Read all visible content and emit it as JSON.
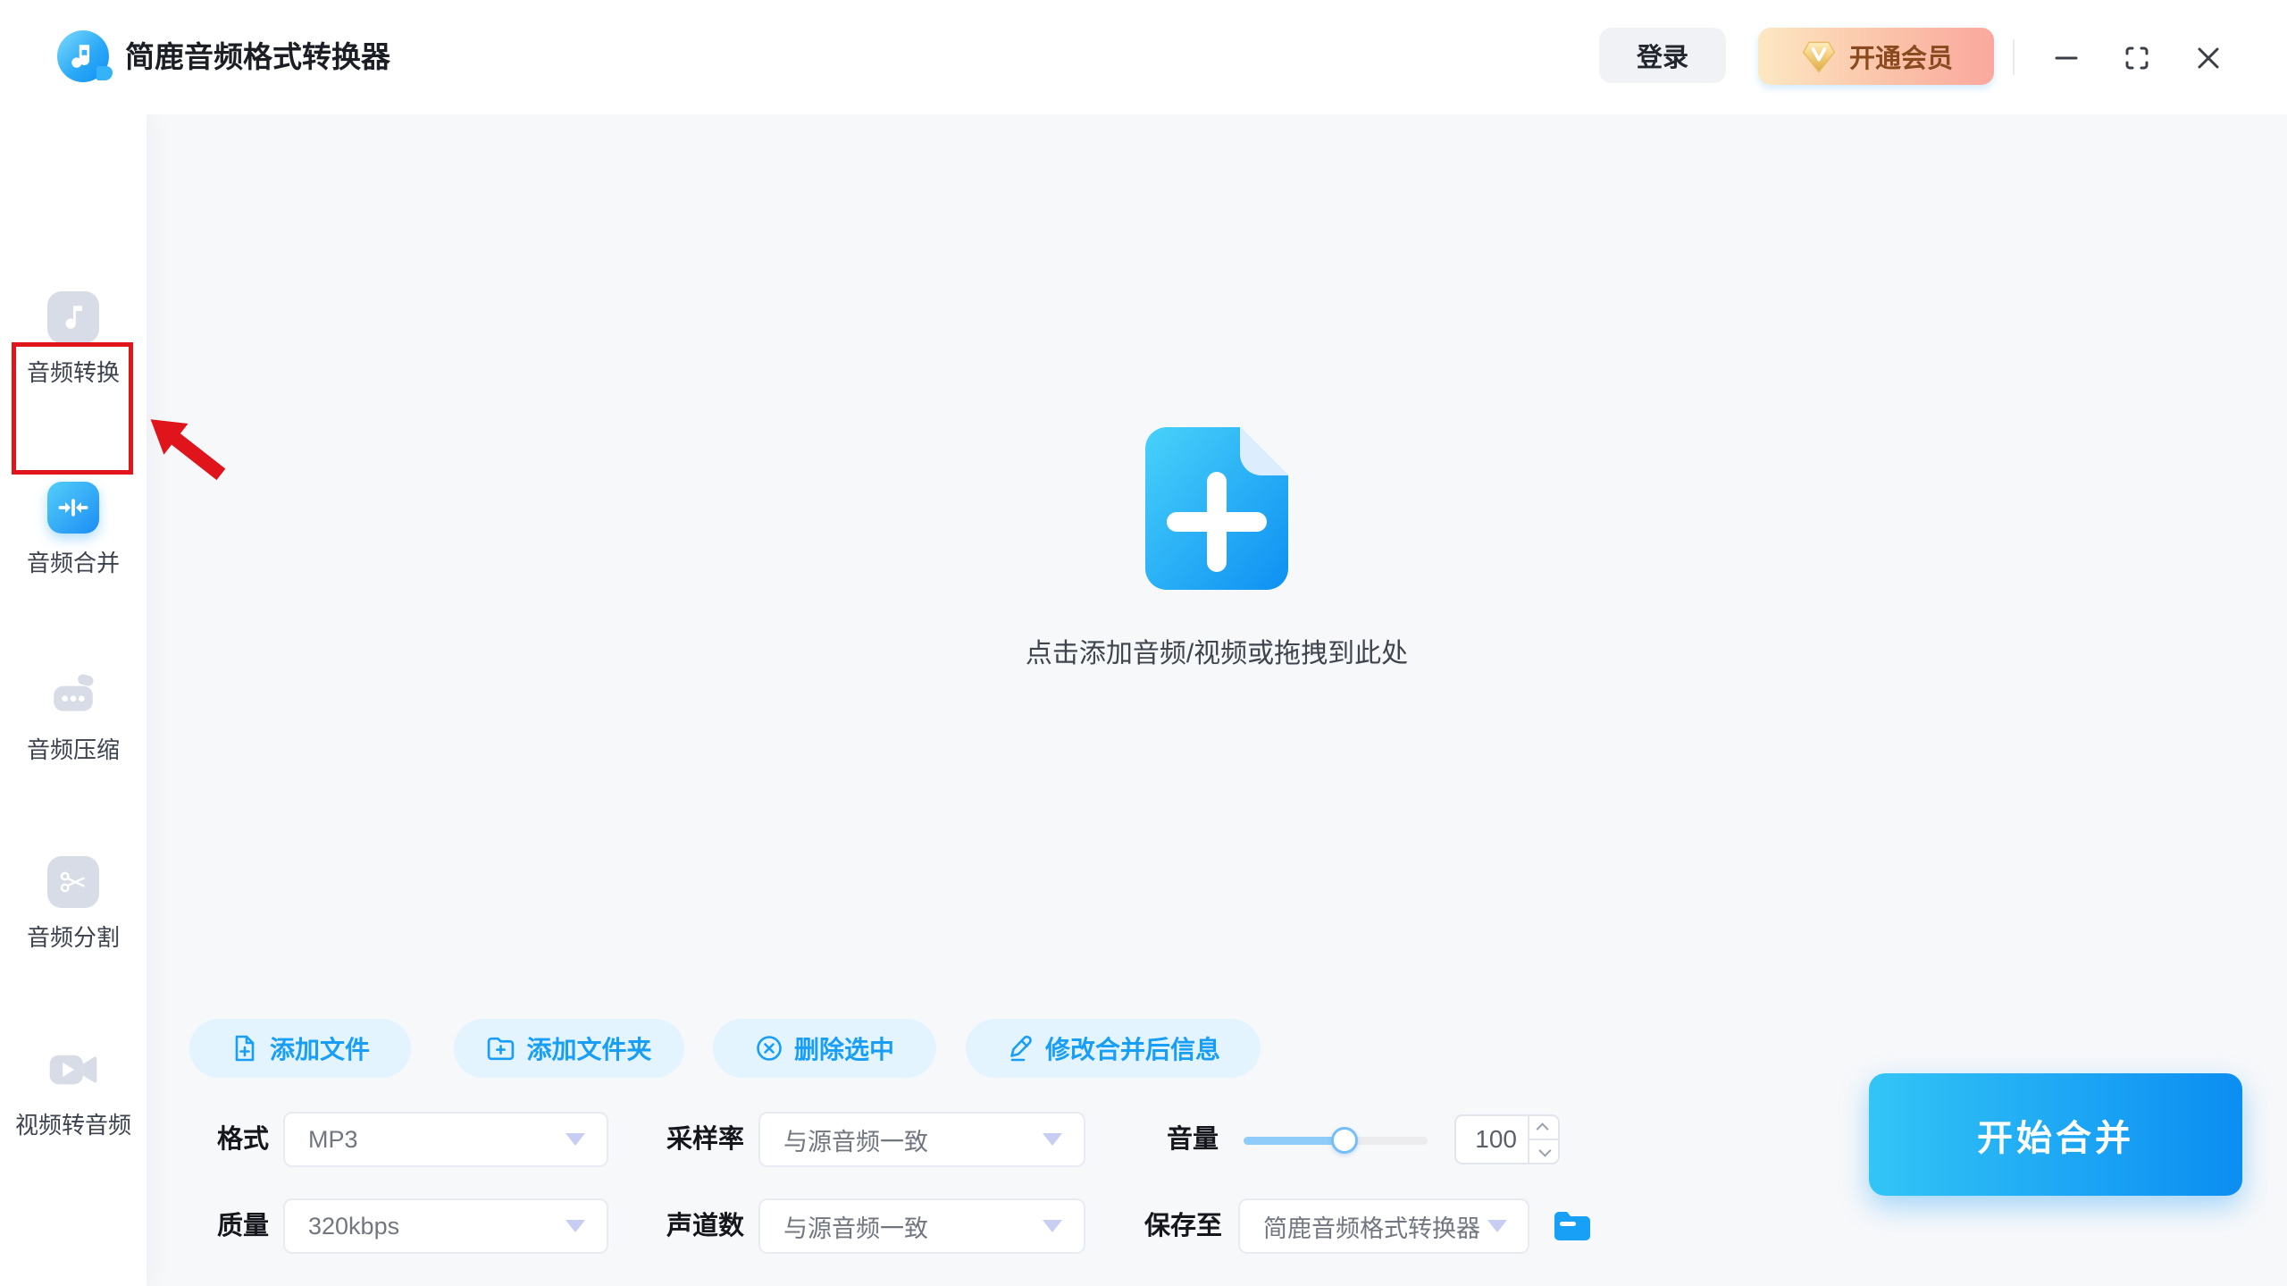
{
  "window": {
    "title": "简鹿音频格式转换器"
  },
  "topbar": {
    "login": "登录",
    "vip": "开通会员"
  },
  "sidebar": {
    "items": [
      {
        "id": "audio-convert",
        "label": "音频转换",
        "active": false
      },
      {
        "id": "audio-merge",
        "label": "音频合并",
        "active": true
      },
      {
        "id": "audio-compress",
        "label": "音频压缩",
        "active": false
      },
      {
        "id": "audio-split",
        "label": "音频分割",
        "active": false
      },
      {
        "id": "video-to-audio",
        "label": "视频转音频",
        "active": false
      }
    ]
  },
  "dropzone": {
    "hint": "点击添加音频/视频或拖拽到此处"
  },
  "toolbar": {
    "add_file": "添加文件",
    "add_folder": "添加文件夹",
    "delete_selected": "删除选中",
    "edit_merge_info": "修改合并后信息"
  },
  "settings": {
    "format": {
      "label": "格式",
      "value": "MP3"
    },
    "sample_rate": {
      "label": "采样率",
      "value": "与源音频一致"
    },
    "volume": {
      "label": "音量",
      "value": "100",
      "slider_percent": 55
    },
    "quality": {
      "label": "质量",
      "value": "320kbps"
    },
    "channels": {
      "label": "声道数",
      "value": "与源音频一致"
    },
    "save_to": {
      "label": "保存至",
      "value": "简鹿音频格式转换器"
    }
  },
  "actions": {
    "start_merge": "开始合并"
  },
  "colors": {
    "accent": "#189ef6",
    "accent_gradient_start": "#33c5f6",
    "accent_gradient_end": "#0b8df2",
    "toolbar_button_bg": "#e3f4fe",
    "vip_gradient_start": "#fce8c2",
    "vip_gradient_end": "#faa89d",
    "vip_text": "#8a4a20",
    "annotation_red": "#e0151c",
    "sidebar_inactive_icon": "#d7dce6"
  }
}
